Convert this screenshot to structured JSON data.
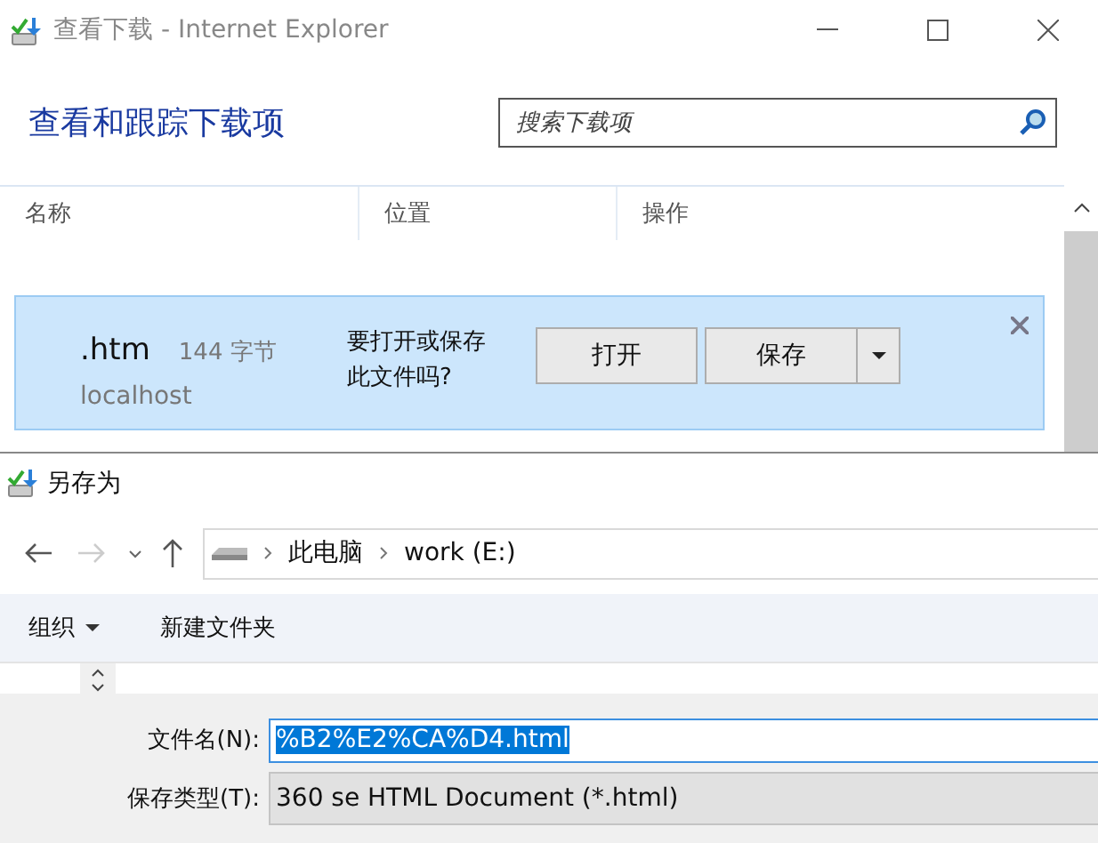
{
  "ie_window": {
    "title": "查看下载 - Internet Explorer",
    "heading": "查看和跟踪下载项",
    "search": {
      "placeholder": "搜索下载项"
    },
    "columns": [
      "名称",
      "位置",
      "操作"
    ],
    "download": {
      "name": ".htm",
      "size": "144 字节",
      "source": "localhost",
      "prompt": "要打开或保存此文件吗?",
      "buttons": [
        "打开",
        "保存"
      ]
    }
  },
  "save_dialog": {
    "title": "另存为",
    "path": [
      "此电脑",
      "work (E:)"
    ],
    "forward_disabled": true,
    "toolbar": [
      {
        "label": "组织",
        "kind": "menu"
      },
      {
        "label": "新建文件夹",
        "kind": "plain"
      }
    ],
    "fields": [
      {
        "label": "文件名(N):",
        "value": "%B2%E2%CA%D4.html",
        "kind": "input"
      },
      {
        "label": "保存类型(T):",
        "value": "360 se HTML Document (*.html)",
        "kind": "select"
      }
    ]
  }
}
